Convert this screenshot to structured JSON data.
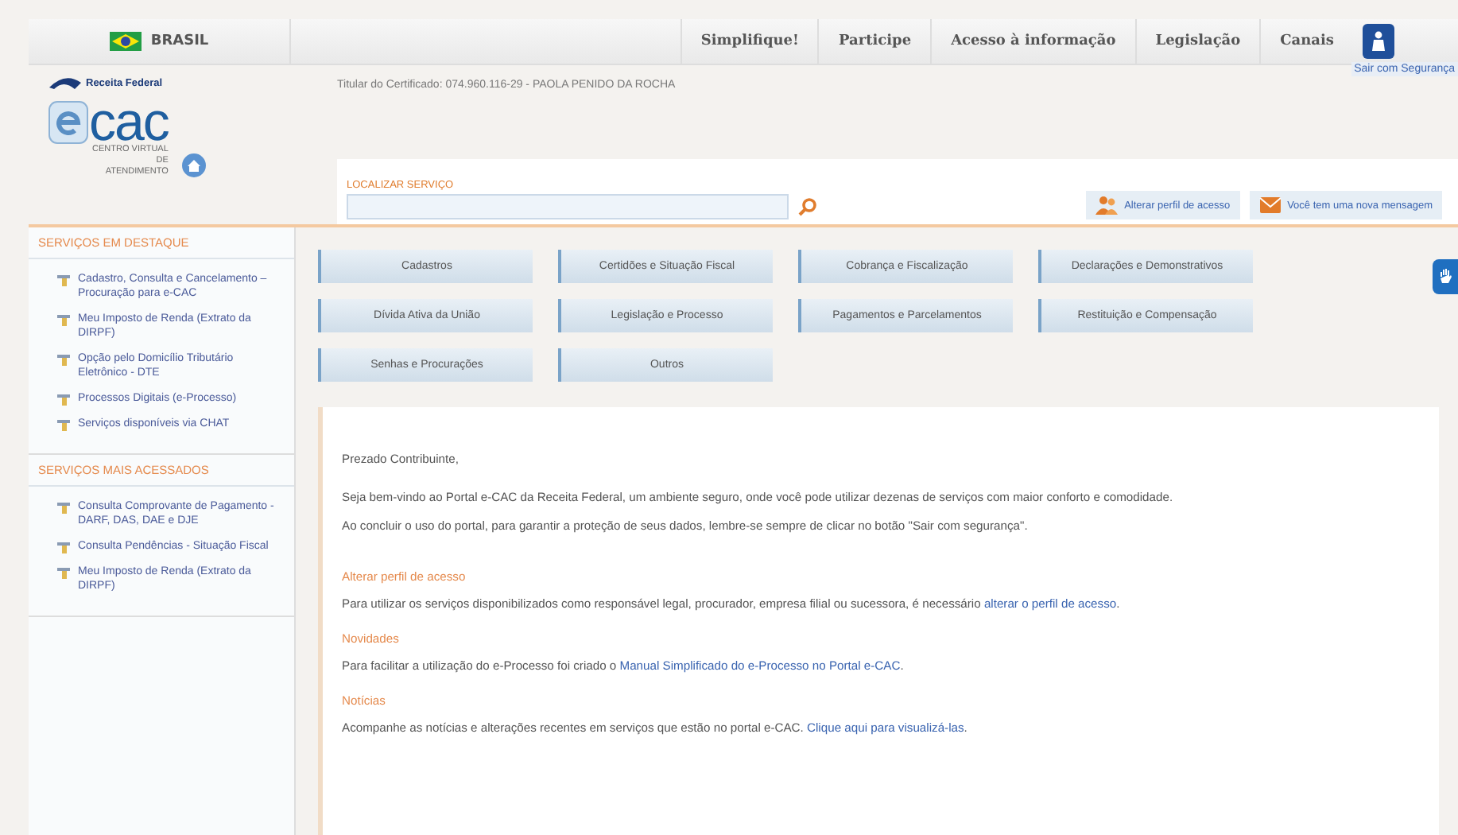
{
  "top_bar": {
    "country": "BRASIL",
    "nav": [
      "Simplifique!",
      "Participe",
      "Acesso à informação",
      "Legislação",
      "Canais"
    ]
  },
  "header": {
    "logo_text": "Receita Federal",
    "ecac_title": "cac",
    "ecac_subtitle": "CENTRO VIRTUAL DE ATENDIMENTO",
    "certificate": "Titular do Certificado: 074.960.116-29 - PAOLA PENIDO DA ROCHA",
    "exit_label": "Sair com Segurança"
  },
  "search": {
    "label": "LOCALIZAR SERVIÇO"
  },
  "actions": [
    {
      "kind": "profile",
      "label": "Alterar perfil de acesso"
    },
    {
      "kind": "message",
      "label": "Você tem uma nova mensagem"
    }
  ],
  "sidebar": [
    {
      "title": "SERVIÇOS EM DESTAQUE",
      "items": [
        "Cadastro, Consulta e Cancelamento – Procuração para e-CAC",
        "Meu Imposto de Renda (Extrato da DIRPF)",
        "Opção pelo Domicílio Tributário Eletrônico - DTE",
        "Processos Digitais (e-Processo)",
        "Serviços disponíveis via CHAT"
      ]
    },
    {
      "title": "SERVIÇOS MAIS ACESSADOS",
      "items": [
        "Consulta Comprovante de Pagamento - DARF, DAS, DAE e DJE",
        "Consulta Pendências - Situação Fiscal",
        "Meu Imposto de Renda (Extrato da DIRPF)"
      ]
    }
  ],
  "categories": [
    "Cadastros",
    "Certidões e Situação Fiscal",
    "Cobrança e Fiscalização",
    "Declarações e Demonstrativos",
    "Dívida Ativa da União",
    "Legislação e Processo",
    "Pagamentos e Parcelamentos",
    "Restituição e Compensação",
    "Senhas e Procurações",
    "Outros"
  ],
  "content": {
    "greeting": "Prezado Contribuinte,",
    "intro": [
      "Seja bem-vindo ao Portal e-CAC da Receita Federal, um ambiente seguro, onde você pode utilizar dezenas de serviços com maior conforto e comodidade.",
      "Ao concluir o uso do portal, para garantir a proteção de seus dados, lembre-se sempre de clicar no botão \"Sair com segurança\"."
    ],
    "sections": [
      {
        "heading": "Alterar perfil de acesso",
        "parts": [
          {
            "kind": "text",
            "text": "Para utilizar os serviços disponibilizados como responsável legal, procurador, empresa filial ou sucessora, é necessário "
          },
          {
            "kind": "link",
            "text": "alterar o perfil de acesso"
          },
          {
            "kind": "text",
            "text": "."
          }
        ]
      },
      {
        "heading": "Novidades",
        "parts": [
          {
            "kind": "text",
            "text": "Para facilitar a utilização do e-Processo foi criado o "
          },
          {
            "kind": "link",
            "text": "Manual Simplificado do e-Processo no Portal e-CAC"
          },
          {
            "kind": "text",
            "text": "."
          }
        ]
      },
      {
        "heading": "Notícias",
        "parts": [
          {
            "kind": "text",
            "text": "Acompanhe as notícias e alterações recentes em serviços que estão no portal e-CAC. "
          },
          {
            "kind": "link",
            "text": "Clique aqui para visualizá-las"
          },
          {
            "kind": "text",
            "text": "."
          }
        ]
      }
    ]
  }
}
